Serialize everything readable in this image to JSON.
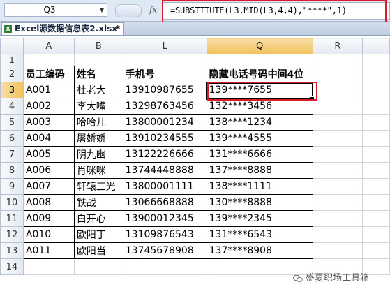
{
  "formula_bar": {
    "name_box": "Q3",
    "fx_label": "fx",
    "formula": "=SUBSTITUTE(L3,MID(L3,4,4),\"****\",1)"
  },
  "workbook_tab": {
    "title": "Excel源数据信息表2.xlsx",
    "close": "*"
  },
  "grid": {
    "columns": [
      "A",
      "B",
      "L",
      "Q",
      "R"
    ],
    "row_numbers": [
      "1",
      "2",
      "3",
      "4",
      "5",
      "6",
      "7",
      "8",
      "9",
      "10",
      "11",
      "12",
      "13",
      "14"
    ],
    "headers": [
      "员工编码",
      "姓名",
      "手机号",
      "隐藏电话号码中间4位"
    ],
    "rows": [
      [
        "A001",
        "杜老大",
        "13910987655",
        "139****7655"
      ],
      [
        "A002",
        "李大嘴",
        "13298763456",
        "132****3456"
      ],
      [
        "A003",
        "哈哈儿",
        "13800001234",
        "138****1234"
      ],
      [
        "A004",
        "屠娇娇",
        "13910234555",
        "139****4555"
      ],
      [
        "A005",
        "阴九幽",
        "13122226666",
        "131****6666"
      ],
      [
        "A006",
        "肖咪咪",
        "13744448888",
        "137****8888"
      ],
      [
        "A007",
        "轩辕三光",
        "13800001111",
        "138****1111"
      ],
      [
        "A008",
        "铁战",
        "13066668888",
        "130****8888"
      ],
      [
        "A009",
        "白开心",
        "13900012345",
        "139****2345"
      ],
      [
        "A010",
        "欧阳丁",
        "13109876543",
        "131****6543"
      ],
      [
        "A011",
        "欧阳当",
        "13745678908",
        "137****8908"
      ]
    ]
  },
  "watermark": "盛夏职场工具箱",
  "colors": {
    "highlight_red": "#d91b2a",
    "selected_header": "#f1c15e"
  }
}
